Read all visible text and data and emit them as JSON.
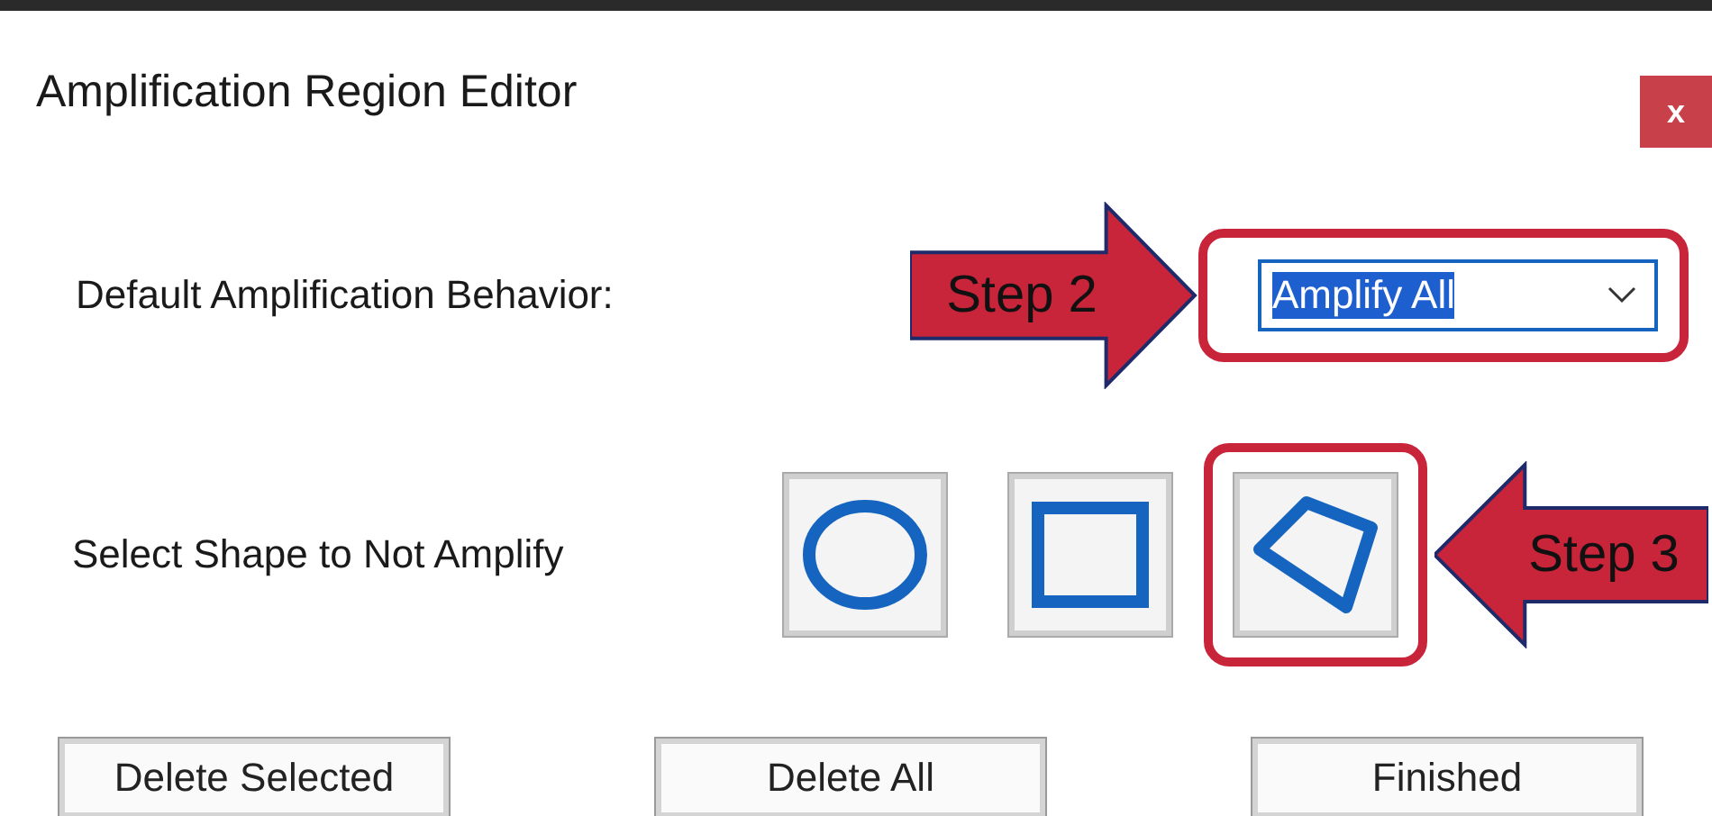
{
  "window": {
    "title": "Amplification Region Editor",
    "close": "x"
  },
  "behavior": {
    "label": "Default Amplification Behavior:",
    "value": "Amplify All",
    "value_selected": true,
    "highlighted": true,
    "annotation": "Step 2"
  },
  "shapes": {
    "label": "Select Shape to Not Amplify",
    "annotation": "Step 3",
    "items": [
      {
        "kind": "circle",
        "highlighted": false
      },
      {
        "kind": "rectangle",
        "highlighted": false
      },
      {
        "kind": "polygon",
        "highlighted": true
      }
    ]
  },
  "buttons": [
    {
      "label": "Delete Selected"
    },
    {
      "label": "Delete All"
    },
    {
      "label": "Finished"
    }
  ]
}
